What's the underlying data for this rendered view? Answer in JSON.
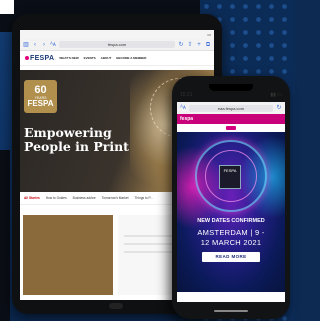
{
  "tablet": {
    "status_time": "",
    "url": "fespa.com",
    "logo": "FESPA",
    "nav_items": [
      "WHAT'S NEW",
      "EVENTS",
      "ABOUT",
      "BECOME A MEMBER"
    ],
    "hero": {
      "badge_number": "60",
      "badge_sub": "YEARS",
      "badge_word": "FESPA",
      "title": "Empowering People in Print",
      "text": ""
    },
    "tabs": [
      "All Stories",
      "How to Guides",
      "Business advice",
      "Tomorrow's Market",
      "Things to P..."
    ],
    "colors": {
      "accent": "#c8000f",
      "brand": "#1a3a78"
    }
  },
  "phone": {
    "status_time": "15:21",
    "url": "eaa.fespa.com",
    "header_logo": "fespa",
    "hero": {
      "badge_text": "FESPA",
      "title": "NEW DATES CONFIRMED",
      "city": "AMSTERDAM | 9 -",
      "date": "12 MARCH 2021",
      "button_label": "READ MORE"
    },
    "colors": {
      "header": "#c8007a",
      "hero": "#2a1f8f"
    }
  }
}
